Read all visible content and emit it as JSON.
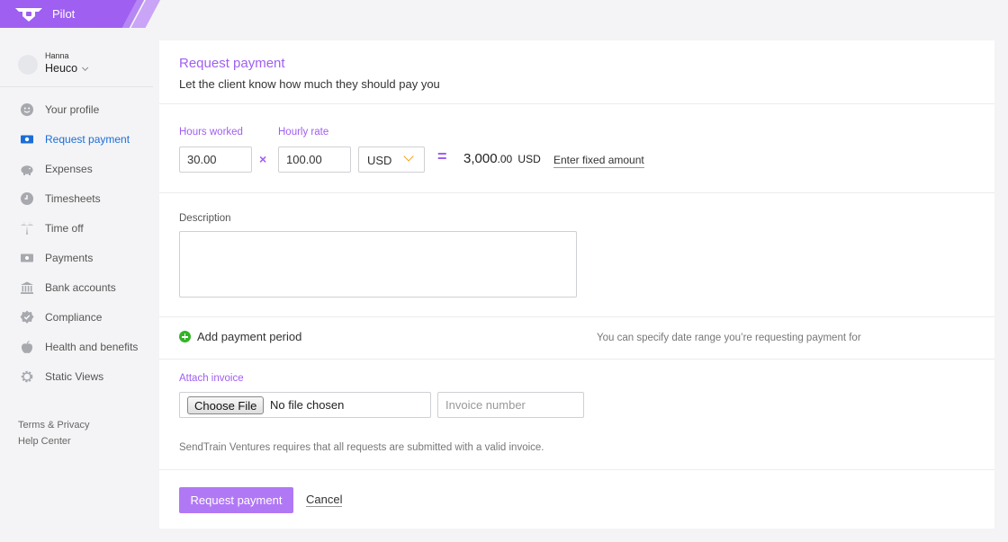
{
  "app": {
    "name": "Pilot"
  },
  "user": {
    "first_name": "Hanna",
    "company": "Heuco"
  },
  "sidebar": {
    "items": [
      {
        "label": "Your profile",
        "icon": "smiley-icon"
      },
      {
        "label": "Request payment",
        "icon": "banknote-icon",
        "active": true
      },
      {
        "label": "Expenses",
        "icon": "piggy-bank-icon"
      },
      {
        "label": "Timesheets",
        "icon": "clock-icon"
      },
      {
        "label": "Time off",
        "icon": "palm-tree-icon"
      },
      {
        "label": "Payments",
        "icon": "cash-icon"
      },
      {
        "label": "Bank accounts",
        "icon": "bank-icon"
      },
      {
        "label": "Compliance",
        "icon": "badge-icon"
      },
      {
        "label": "Health and benefits",
        "icon": "apple-icon"
      },
      {
        "label": "Static Views",
        "icon": "gear-icon"
      }
    ],
    "footer": {
      "terms": "Terms & Privacy",
      "help": "Help Center"
    }
  },
  "form": {
    "title": "Request payment",
    "subtitle": "Let the client know how much they should pay you",
    "hours": {
      "label": "Hours worked",
      "value": "30.00"
    },
    "times_sign": "×",
    "rate": {
      "label": "Hourly rate",
      "value": "100.00"
    },
    "currency": "USD",
    "equals_sign": "=",
    "total": {
      "whole": "3,000",
      "decimal": ".00",
      "currency": "USD"
    },
    "fixed_amount_link": "Enter fixed amount",
    "description": {
      "label": "Description",
      "value": ""
    },
    "period": {
      "label": "Add payment period",
      "hint": "You can specify date range you’re requesting payment for"
    },
    "invoice": {
      "label": "Attach invoice",
      "choose_file": "Choose File",
      "file_status": "No file chosen",
      "number_placeholder": "Invoice number",
      "note": "SendTrain Ventures requires that all requests are submitted with a valid invoice."
    },
    "actions": {
      "submit": "Request payment",
      "cancel": "Cancel"
    }
  },
  "colors": {
    "brand": "#9f5ff1",
    "active_nav": "#1a6ed8",
    "button": "#b178f5",
    "add": "#34b327",
    "caret": "#f0a31b"
  }
}
